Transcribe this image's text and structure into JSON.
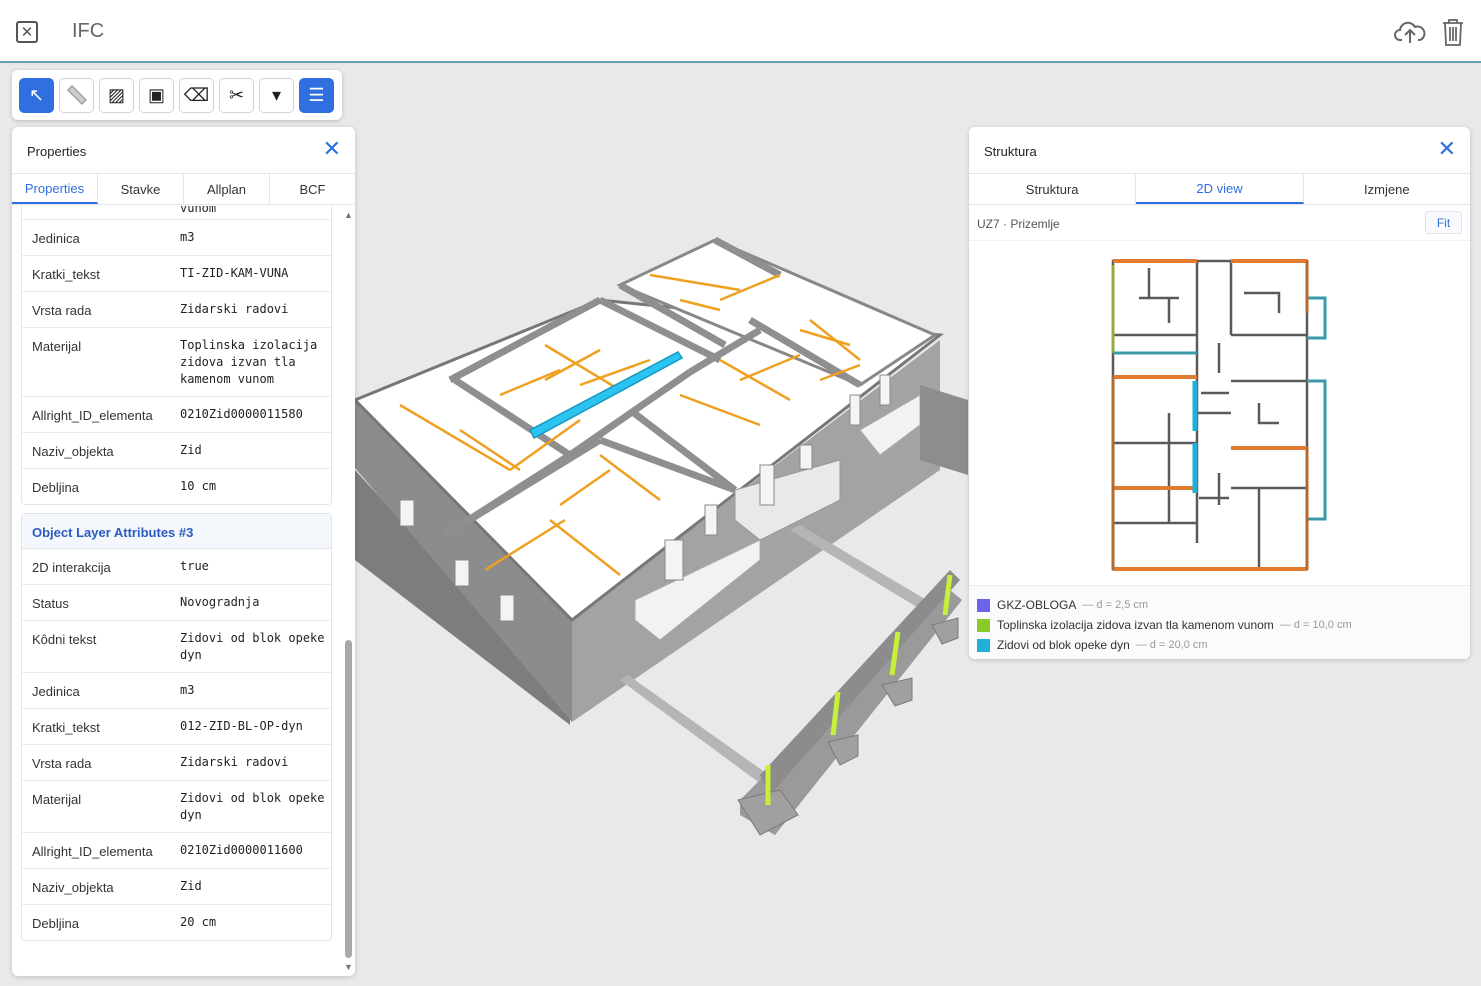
{
  "app": {
    "title": "IFC",
    "close_icon": "close-x-icon",
    "upload_icon": "cloud-upload-icon",
    "delete_icon": "trash-icon"
  },
  "toolbar": {
    "tools": [
      {
        "name": "select-tool",
        "glyph": "↖",
        "active": true
      },
      {
        "name": "measure-tool",
        "glyph": "📏",
        "active": false
      },
      {
        "name": "section-hatch-tool",
        "glyph": "▨",
        "active": false
      },
      {
        "name": "isolate-tool",
        "glyph": "▣",
        "active": false
      },
      {
        "name": "erase-tool",
        "glyph": "⌫",
        "active": false
      },
      {
        "name": "cut-tool",
        "glyph": "✂",
        "active": false
      },
      {
        "name": "more-dropdown",
        "glyph": "▾",
        "active": false
      },
      {
        "name": "menu-tool",
        "glyph": "☰",
        "active": true
      }
    ]
  },
  "properties": {
    "title": "Properties",
    "tabs": [
      "Properties",
      "Stavke",
      "Allplan",
      "BCF"
    ],
    "active_tab": 0,
    "group1": {
      "partial_value": "vunom",
      "rows": [
        {
          "k": "Jedinica",
          "v": "m3"
        },
        {
          "k": "Kratki_tekst",
          "v": "TI-ZID-KAM-VUNA"
        },
        {
          "k": "Vrsta rada",
          "v": "Zidarski radovi"
        },
        {
          "k": "Materijal",
          "v": "Toplinska izolacija zidova izvan tla kamenom vunom"
        },
        {
          "k": "Allright_ID_elementa",
          "v": "0210Zid0000011580"
        },
        {
          "k": "Naziv_objekta",
          "v": "Zid"
        },
        {
          "k": "Debljina",
          "v": "10 cm"
        }
      ]
    },
    "group2": {
      "title": "Object Layer Attributes #3",
      "rows": [
        {
          "k": "2D interakcija",
          "v": "true"
        },
        {
          "k": "Status",
          "v": "Novogradnja"
        },
        {
          "k": "Kôdni tekst",
          "v": "Zidovi od blok opeke dyn"
        },
        {
          "k": "Jedinica",
          "v": "m3"
        },
        {
          "k": "Kratki_tekst",
          "v": "012-ZID-BL-OP-dyn"
        },
        {
          "k": "Vrsta rada",
          "v": "Zidarski radovi"
        },
        {
          "k": "Materijal",
          "v": "Zidovi od blok opeke dyn"
        },
        {
          "k": "Allright_ID_elementa",
          "v": "0210Zid0000011600"
        },
        {
          "k": "Naziv_objekta",
          "v": "Zid"
        },
        {
          "k": "Debljina",
          "v": "20 cm"
        }
      ]
    }
  },
  "struktura": {
    "title": "Struktura",
    "tabs": [
      "Struktura",
      "2D view",
      "Izmjene"
    ],
    "active_tab": 1,
    "breadcrumb": "UZ7 · Prizemlje",
    "fit_label": "Fit",
    "legend": [
      {
        "label": "GKZ-OBLOGA",
        "meta": "— d = 2,5 cm",
        "color": "#6b63e8"
      },
      {
        "label": "Toplinska izolacija zidova izvan tla kamenom vunom",
        "meta": "— d = 10,0 cm",
        "color": "#8ac926"
      },
      {
        "label": "Zidovi od blok opeke dyn",
        "meta": "— d = 20,0 cm",
        "color": "#1fb0d8"
      }
    ]
  },
  "colors": {
    "accent": "#2f6fe0",
    "selected_wall": "#2bc3f0",
    "insulation": "#c6f03a",
    "orange_lines": "#f0a020"
  }
}
